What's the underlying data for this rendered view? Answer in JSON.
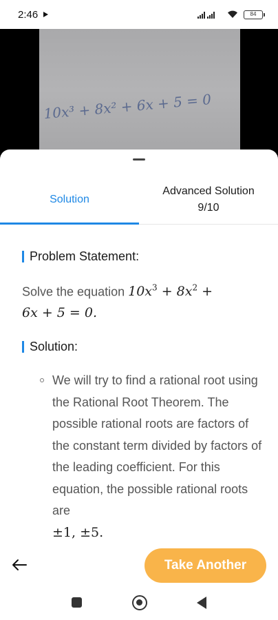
{
  "status_bar": {
    "time": "2:46",
    "battery": "84"
  },
  "photo": {
    "handwritten_equation": "10x³ + 8x² + 6x + 5 = 0"
  },
  "tabs": [
    {
      "label": "Solution",
      "sub": ""
    },
    {
      "label": "Advanced Solution",
      "sub": "9/10"
    }
  ],
  "problem": {
    "heading": "Problem Statement:",
    "text_prefix": "Solve the equation ",
    "equation_line1": "10x",
    "exp3": "3",
    "mid1": " + 8x",
    "exp2": "2",
    "mid2": " +",
    "equation_line2": "6x + 5 = 0."
  },
  "solution": {
    "heading": "Solution:",
    "bullet_text": "We will try to find a rational root using the Rational Root Theorem. The possible rational roots are factors of the constant term divided by factors of the leading coefficient. For this equation, the possible rational roots are",
    "bullet_math": "±1, ±5."
  },
  "actions": {
    "take_another": "Take Another"
  },
  "colors": {
    "accent": "#1e88e5",
    "button": "#f9b44a"
  }
}
